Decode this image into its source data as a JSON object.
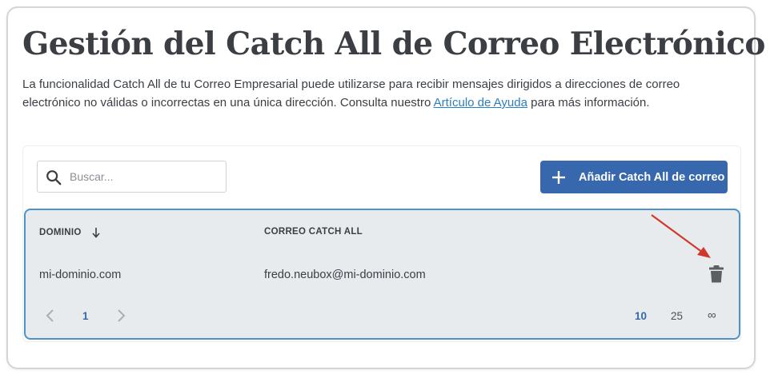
{
  "page": {
    "title": "Gestión del Catch All de Correo Electrónico",
    "description_before_link": "La funcionalidad Catch All de tu Correo Empresarial puede utilizarse para recibir mensajes dirigidos a direcciones de correo electrónico no válidas o incorrectas en una única dirección. Consulta nuestro ",
    "help_link_text": "Artículo de Ayuda",
    "description_after_link": " para más información."
  },
  "toolbar": {
    "search_placeholder": "Buscar...",
    "add_button_label": "Añadir Catch All de correo"
  },
  "table": {
    "columns": [
      "DOMINIO",
      "CORREO CATCH ALL"
    ],
    "rows": [
      {
        "domain": "mi-dominio.com",
        "catch_all_email": "fredo.neubox@mi-dominio.com"
      }
    ]
  },
  "pagination": {
    "current_page": "1",
    "page_sizes": [
      "10",
      "25",
      "∞"
    ],
    "selected_page_size": "10"
  },
  "icons": {
    "search": "search-icon",
    "add": "plus-icon",
    "sort": "arrow-down-icon",
    "delete": "trash-icon",
    "prev": "chevron-left-icon",
    "next": "chevron-right-icon",
    "annotation": "red-arrow"
  },
  "colors": {
    "primary": "#3768ad",
    "link": "#2a7fbf",
    "table_border": "#4c93c9",
    "table_bg": "#e8ebee",
    "annotation": "#d0382b"
  }
}
